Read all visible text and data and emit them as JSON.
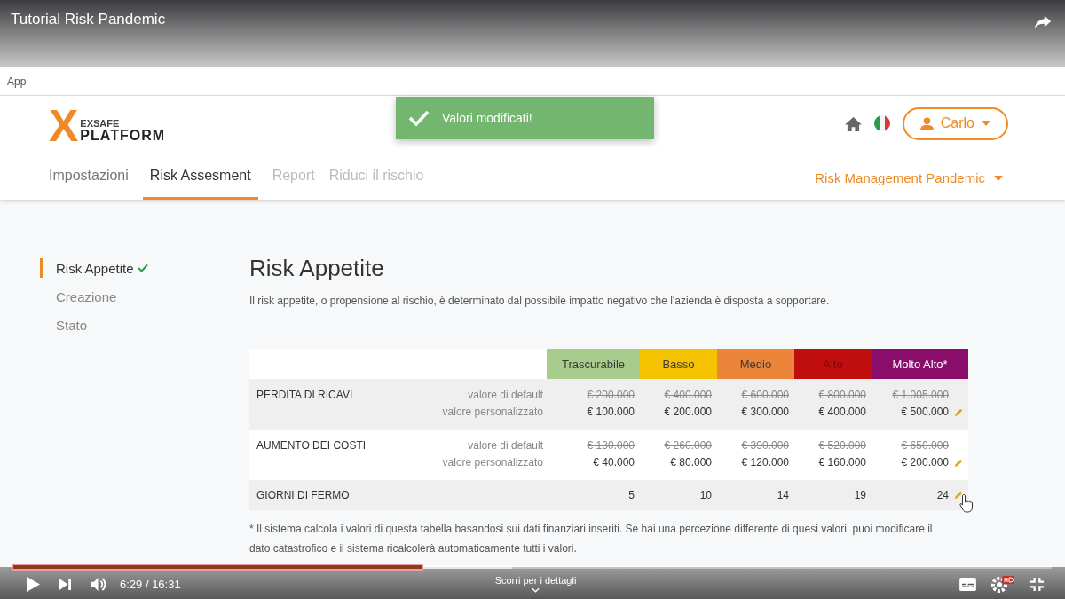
{
  "video": {
    "title": "Tutorial Risk Pandemic",
    "time": "6:29 / 16:31",
    "progress": {
      "level": 0.393
    },
    "scroll_hint": "Scorri per i dettagli"
  },
  "browser": {
    "label": "App"
  },
  "header": {
    "logo_mark": "X",
    "logo_top": "EXSAFE",
    "logo_bottom": "PLATFORM",
    "toast": "Valori modificati!",
    "user": "Carlo",
    "project": "Risk Management Pandemic",
    "tabs": [
      {
        "label": "Impostazioni",
        "selected": false,
        "disabled": false
      },
      {
        "label": "Risk Assesment",
        "selected": true,
        "disabled": false
      },
      {
        "label": "Report",
        "selected": false,
        "disabled": true
      },
      {
        "label": "Riduci il rischio",
        "selected": false,
        "disabled": true
      }
    ]
  },
  "sidebar": {
    "items": [
      {
        "label": "Risk Appetite",
        "selected": true,
        "done": true
      },
      {
        "label": "Creazione",
        "selected": false,
        "done": false
      },
      {
        "label": "Stato",
        "selected": false,
        "done": false
      }
    ]
  },
  "main": {
    "title": "Risk Appetite",
    "description": "Il risk appetite, o propensione al rischio, è determinato dal possibile impatto negativo che l'azienda è disposta a sopportare.",
    "table": {
      "columns": [
        {
          "label": "Trascurabile",
          "color": "#a8cc8c"
        },
        {
          "label": "Basso",
          "color": "#f5c200"
        },
        {
          "label": "Medio",
          "color": "#ec843a"
        },
        {
          "label": "Alto",
          "color": "#c00d0d"
        },
        {
          "label": "Molto Alto*",
          "color": "#8a0c6b"
        }
      ],
      "rows": [
        {
          "kind": "money",
          "label": "PERDITA DI RICAVI",
          "default_label": "valore di default",
          "custom_label": "valore personalizzato",
          "defaults": [
            "€ 200.000",
            "€ 400.000",
            "€ 600.000",
            "€ 800.000",
            "€ 1.005.000"
          ],
          "values": [
            "€ 100.000",
            "€ 200.000",
            "€ 300.000",
            "€ 400.000",
            "€ 500.000"
          ],
          "editable": true
        },
        {
          "kind": "money",
          "label": "AUMENTO DEI COSTI",
          "default_label": "valore di default",
          "custom_label": "valore personalizzato",
          "defaults": [
            "€ 130.000",
            "€ 260.000",
            "€ 390.000",
            "€ 520.000",
            "€ 650.000"
          ],
          "values": [
            "€ 40.000",
            "€ 80.000",
            "€ 120.000",
            "€ 160.000",
            "€ 200.000"
          ],
          "editable": true
        },
        {
          "kind": "days",
          "label": "GIORNI DI FERMO",
          "values": [
            "5",
            "10",
            "14",
            "19",
            "24"
          ],
          "editable": true
        }
      ]
    },
    "footnote": "* Il sistema calcola i valori di questa tabella basandosi sui dati finanziari inseriti. Se hai una percezione differente di quesi valori, puoi modificare il dato catastrofico e il sistema ricalcolerà automaticamente tutti i valori."
  }
}
